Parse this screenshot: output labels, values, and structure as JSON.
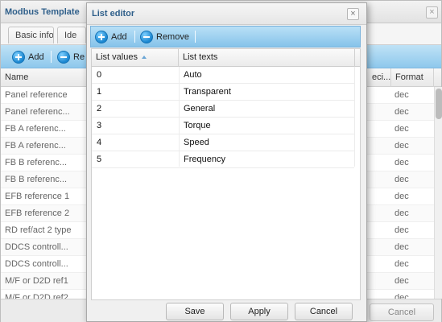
{
  "background": {
    "title": "Modbus Template",
    "tabs": [
      "Basic info",
      "Ide"
    ],
    "toolbar": {
      "add_label": "Add",
      "remove_label": "Re"
    },
    "columns": {
      "name": "Name",
      "precision": "eci...",
      "format": "Format"
    },
    "rows": [
      {
        "name": "Panel reference",
        "format": "dec"
      },
      {
        "name": "Panel referenc...",
        "format": "dec"
      },
      {
        "name": "FB A referenc...",
        "format": "dec"
      },
      {
        "name": "FB A referenc...",
        "format": "dec"
      },
      {
        "name": "FB B referenc...",
        "format": "dec"
      },
      {
        "name": "FB B referenc...",
        "format": "dec"
      },
      {
        "name": "EFB reference 1",
        "format": "dec"
      },
      {
        "name": "EFB reference 2",
        "format": "dec"
      },
      {
        "name": "RD ref/act 2 type",
        "format": "dec"
      },
      {
        "name": "DDCS controll...",
        "format": "dec"
      },
      {
        "name": "DDCS controll...",
        "format": "dec"
      },
      {
        "name": "M/F or D2D ref1",
        "format": "dec"
      },
      {
        "name": "M/F or D2D ref2",
        "format": "dec"
      }
    ],
    "cancel_label": "Cancel"
  },
  "dialog": {
    "title": "List editor",
    "close_glyph": "×",
    "toolbar": {
      "add_label": "Add",
      "remove_label": "Remove"
    },
    "columns": {
      "values": "List values",
      "texts": "List texts"
    },
    "rows": [
      {
        "value": "0",
        "text": "Auto"
      },
      {
        "value": "1",
        "text": "Transparent"
      },
      {
        "value": "2",
        "text": "General"
      },
      {
        "value": "3",
        "text": "Torque"
      },
      {
        "value": "4",
        "text": "Speed"
      },
      {
        "value": "5",
        "text": "Frequency"
      }
    ],
    "buttons": {
      "save": "Save",
      "apply": "Apply",
      "cancel": "Cancel"
    }
  }
}
